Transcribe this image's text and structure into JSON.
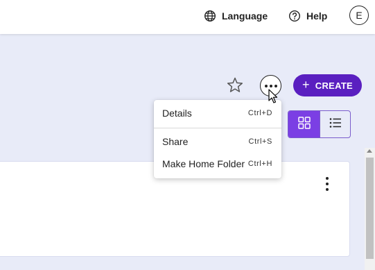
{
  "header": {
    "language_label": "Language",
    "help_label": "Help",
    "avatar_initial": "E"
  },
  "toolbar": {
    "create_label": "CREATE"
  },
  "more_menu": {
    "items": [
      {
        "label": "Details",
        "shortcut": "Ctrl+D"
      },
      {
        "label": "Share",
        "shortcut": "Ctrl+S"
      },
      {
        "label": "Make Home Folder",
        "shortcut": "Ctrl+H"
      }
    ]
  },
  "view_toggle": {
    "selected": "grid"
  },
  "colors": {
    "primary": "#5a1fc0",
    "toggle_active": "#7b3fe4",
    "background": "#e8ebf8"
  },
  "icons": [
    "globe-icon",
    "help-circle-icon",
    "star-icon",
    "more-horizontal-icon",
    "plus-icon",
    "grid-view-icon",
    "list-view-icon",
    "more-vertical-icon",
    "mouse-pointer-icon"
  ]
}
